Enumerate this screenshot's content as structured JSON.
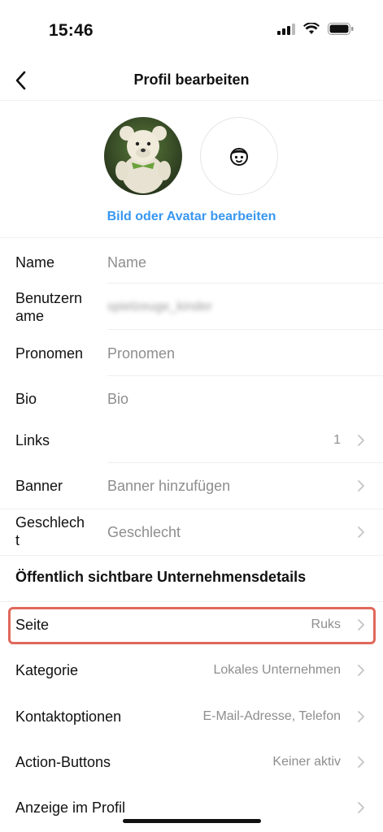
{
  "status": {
    "time": "15:46"
  },
  "nav": {
    "title": "Profil bearbeiten"
  },
  "profile": {
    "edit_label": "Bild oder Avatar bearbeiten"
  },
  "fields": [
    {
      "label": "Name",
      "value": "Name"
    },
    {
      "label": "Benutzern\name",
      "value": "spielzeuge_kinder"
    },
    {
      "label": "Pronomen",
      "value": "Pronomen"
    },
    {
      "label": "Bio",
      "value": "Bio"
    },
    {
      "label": "Links",
      "value": "1"
    },
    {
      "label": "Banner",
      "value": "Banner hinzufügen"
    },
    {
      "label": "Geschlech\nt",
      "value": "Geschlecht"
    }
  ],
  "business": {
    "section_title": "Öffentlich sichtbare Unternehmensdetails",
    "rows": [
      {
        "label": "Seite",
        "value": "Ruks"
      },
      {
        "label": "Kategorie",
        "value": "Lokales Unternehmen"
      },
      {
        "label": "Kontaktoptionen",
        "value": "E-Mail-Adresse, Telefon"
      },
      {
        "label": "Action-Buttons",
        "value": "Keiner aktiv"
      },
      {
        "label": "Anzeige im Profil",
        "value": ""
      }
    ]
  },
  "colors": {
    "link": "#3897f0",
    "highlight": "#e0685c"
  },
  "icons": [
    "chevron-left-icon",
    "avatar-face-icon",
    "chevron-right-icon",
    "signal-icon",
    "wifi-icon",
    "battery-icon"
  ]
}
